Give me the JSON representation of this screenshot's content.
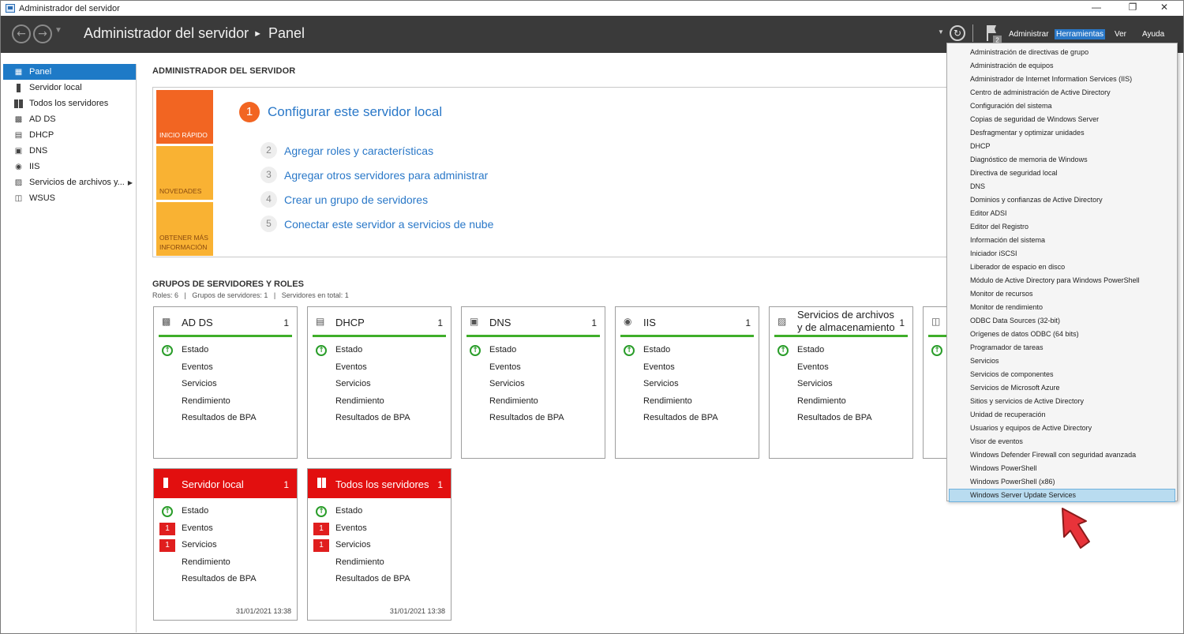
{
  "window": {
    "title": "Administrador del servidor"
  },
  "header": {
    "app_name": "Administrador del servidor",
    "current_page": "Panel",
    "notification_count": "2",
    "menus": [
      "Administrar",
      "Herramientas",
      "Ver",
      "Ayuda"
    ]
  },
  "sidebar": {
    "items": [
      {
        "label": "Panel",
        "icon": "dashboard-icon"
      },
      {
        "label": "Servidor local",
        "icon": "server-icon"
      },
      {
        "label": "Todos los servidores",
        "icon": "servers-icon"
      },
      {
        "label": "AD DS",
        "icon": "ad-ds-icon"
      },
      {
        "label": "DHCP",
        "icon": "dhcp-icon"
      },
      {
        "label": "DNS",
        "icon": "dns-icon"
      },
      {
        "label": "IIS",
        "icon": "iis-icon"
      },
      {
        "label": "Servicios de archivos y...",
        "icon": "file-services-icon"
      },
      {
        "label": "WSUS",
        "icon": "wsus-icon"
      }
    ]
  },
  "main": {
    "title": "ADMINISTRADOR DEL SERVIDOR",
    "quick_start": {
      "tabs": [
        "INICIO RÁPIDO",
        "NOVEDADES",
        "OBTENER MÁS INFORMACIÓN"
      ],
      "steps": [
        {
          "num": "1",
          "label": "Configurar este servidor local"
        },
        {
          "num": "2",
          "label": "Agregar roles y características"
        },
        {
          "num": "3",
          "label": "Agregar otros servidores para administrar"
        },
        {
          "num": "4",
          "label": "Crear un grupo de servidores"
        },
        {
          "num": "5",
          "label": "Conectar este servidor a servicios de nube"
        }
      ]
    },
    "groups": {
      "title": "GRUPOS DE SERVIDORES Y ROLES",
      "summary": "Roles: 6   |   Grupos de servidores: 1   |   Servidores en total: 1",
      "row_labels": [
        "Estado",
        "Eventos",
        "Servicios",
        "Rendimiento",
        "Resultados de BPA"
      ],
      "tiles": [
        {
          "name": "AD DS",
          "count": "1"
        },
        {
          "name": "DHCP",
          "count": "1"
        },
        {
          "name": "DNS",
          "count": "1"
        },
        {
          "name": "IIS",
          "count": "1"
        },
        {
          "name": "Servicios de archivos y de almacenamiento",
          "count": "1"
        }
      ],
      "red_tiles": [
        {
          "name": "Servidor local",
          "count": "1",
          "events_badge": "1",
          "services_badge": "1",
          "date": "31/01/2021 13:38"
        },
        {
          "name": "Todos los servidores",
          "count": "1",
          "events_badge": "1",
          "services_badge": "1",
          "date": "31/01/2021 13:38"
        }
      ]
    }
  },
  "tools_menu": {
    "items": [
      "Administración de directivas de grupo",
      "Administración de equipos",
      "Administrador de Internet Information Services (IIS)",
      "Centro de administración de Active Directory",
      "Configuración del sistema",
      "Copias de seguridad de Windows Server",
      "Desfragmentar y optimizar unidades",
      "DHCP",
      "Diagnóstico de memoria de Windows",
      "Directiva de seguridad local",
      "DNS",
      "Dominios y confianzas de Active Directory",
      "Editor ADSI",
      "Editor del Registro",
      "Información del sistema",
      "Iniciador iSCSI",
      "Liberador de espacio en disco",
      "Módulo de Active Directory para Windows PowerShell",
      "Monitor de recursos",
      "Monitor de rendimiento",
      "ODBC Data Sources (32-bit)",
      "Orígenes de datos ODBC (64 bits)",
      "Programador de tareas",
      "Servicios",
      "Servicios de componentes",
      "Servicios de Microsoft Azure",
      "Sitios y servicios de Active Directory",
      "Unidad de recuperación",
      "Usuarios y equipos de Active Directory",
      "Visor de eventos",
      "Windows Defender Firewall con seguridad avanzada",
      "Windows PowerShell",
      "Windows PowerShell (x86)",
      "Windows Server Update Services"
    ],
    "highlighted": "Windows Server Update Services"
  },
  "colors": {
    "header_bg": "#3a3a3a",
    "accent_blue": "#2a78c8",
    "orange": "#f26522",
    "yellow": "#f9b233",
    "ok_green": "#3fae2a",
    "alert_red": "#e20f0f"
  }
}
